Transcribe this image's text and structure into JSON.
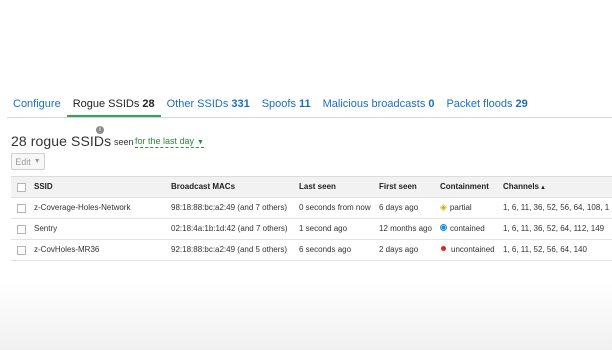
{
  "tabs": [
    {
      "label": "Configure",
      "count": ""
    },
    {
      "label": "Rogue SSIDs",
      "count": "28"
    },
    {
      "label": "Other SSIDs",
      "count": "331"
    },
    {
      "label": "Spoofs",
      "count": "11"
    },
    {
      "label": "Malicious broadcasts",
      "count": "0"
    },
    {
      "label": "Packet floods",
      "count": "29"
    }
  ],
  "heading": {
    "title": "28 rogue SSIDs",
    "info_icon": "info-icon",
    "seen_label": "seen",
    "seen_value": "for the last day"
  },
  "toolbar": {
    "edit_label": "Edit"
  },
  "table": {
    "columns": [
      "SSID",
      "Broadcast MACs",
      "Last seen",
      "First seen",
      "Containment",
      "Channels"
    ],
    "sort_indicator": "▲",
    "rows": [
      {
        "ssid": "z-Coverage-Holes-Network",
        "macs": "98:18:88:bc:a2:49 (and 7 others)",
        "last_seen": "0 seconds from now",
        "first_seen": "6 days ago",
        "containment": "partial",
        "channels": "1, 6, 11, 36, 52, 56, 64, 108, 1"
      },
      {
        "ssid": "Sentry",
        "macs": "02:18:4a:1b:1d:42 (and 7 others)",
        "last_seen": "1 second ago",
        "first_seen": "12 months ago",
        "containment": "contained",
        "channels": "1, 6, 11, 36, 52, 64, 112, 149"
      },
      {
        "ssid": "z-CovHoles-MR36",
        "macs": "92:18:88:bc:a2:49 (and 5 others)",
        "last_seen": "6 seconds ago",
        "first_seen": "2 days ago",
        "containment": "uncontained",
        "channels": "1, 6, 11, 52, 56, 64, 140"
      }
    ]
  },
  "colors": {
    "link": "#1a6fc4",
    "active_tab_underline": "#2aa84a",
    "seen_value": "#2a8a3a",
    "partial": "#e0a200",
    "contained": "#1f8ad6",
    "uncontained": "#e0251b"
  }
}
